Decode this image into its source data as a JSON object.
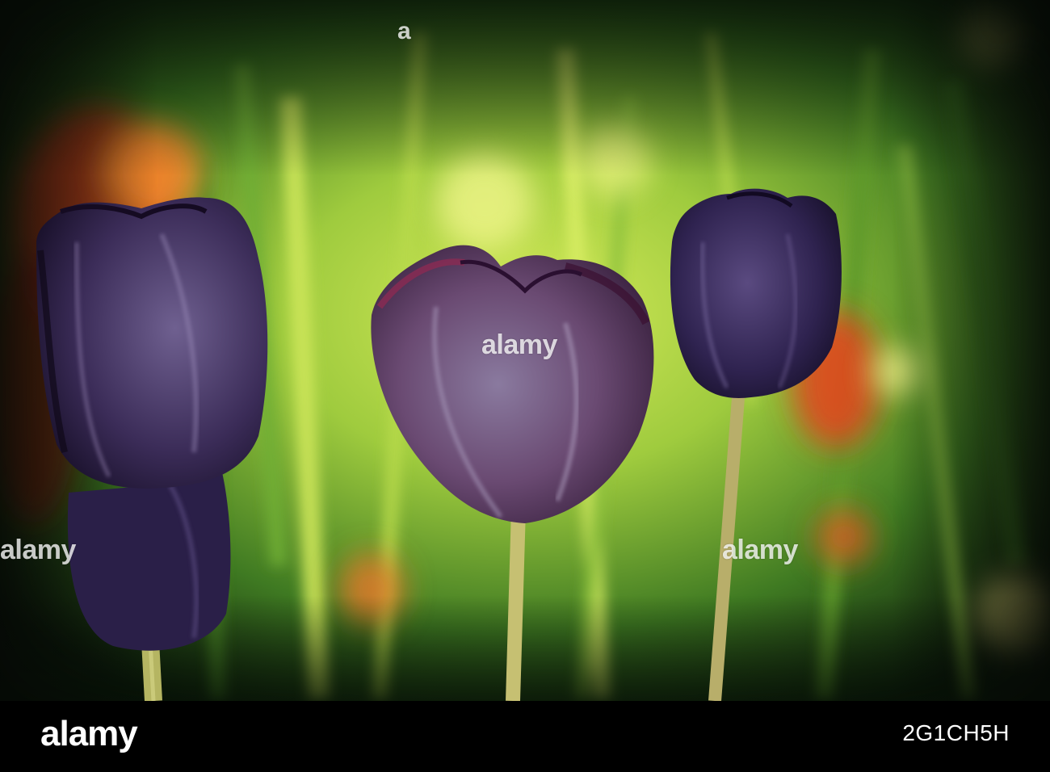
{
  "image": {
    "subject": "three dark purple tulips in front of a blurred green garden",
    "colors": {
      "background_green": "#7fb33a",
      "bright_yellow_green": "#c7e04a",
      "petal_purple": "#3a2a55",
      "petal_highlight": "#7a6b95",
      "orange_tulip": "#d9501e",
      "stem": "#a9a95a"
    }
  },
  "watermarks": {
    "left": "alamy",
    "center": "alamy",
    "right": "alamy",
    "top": "a"
  },
  "footer": {
    "logo": "alamy",
    "image_id": "2G1CH5H"
  }
}
